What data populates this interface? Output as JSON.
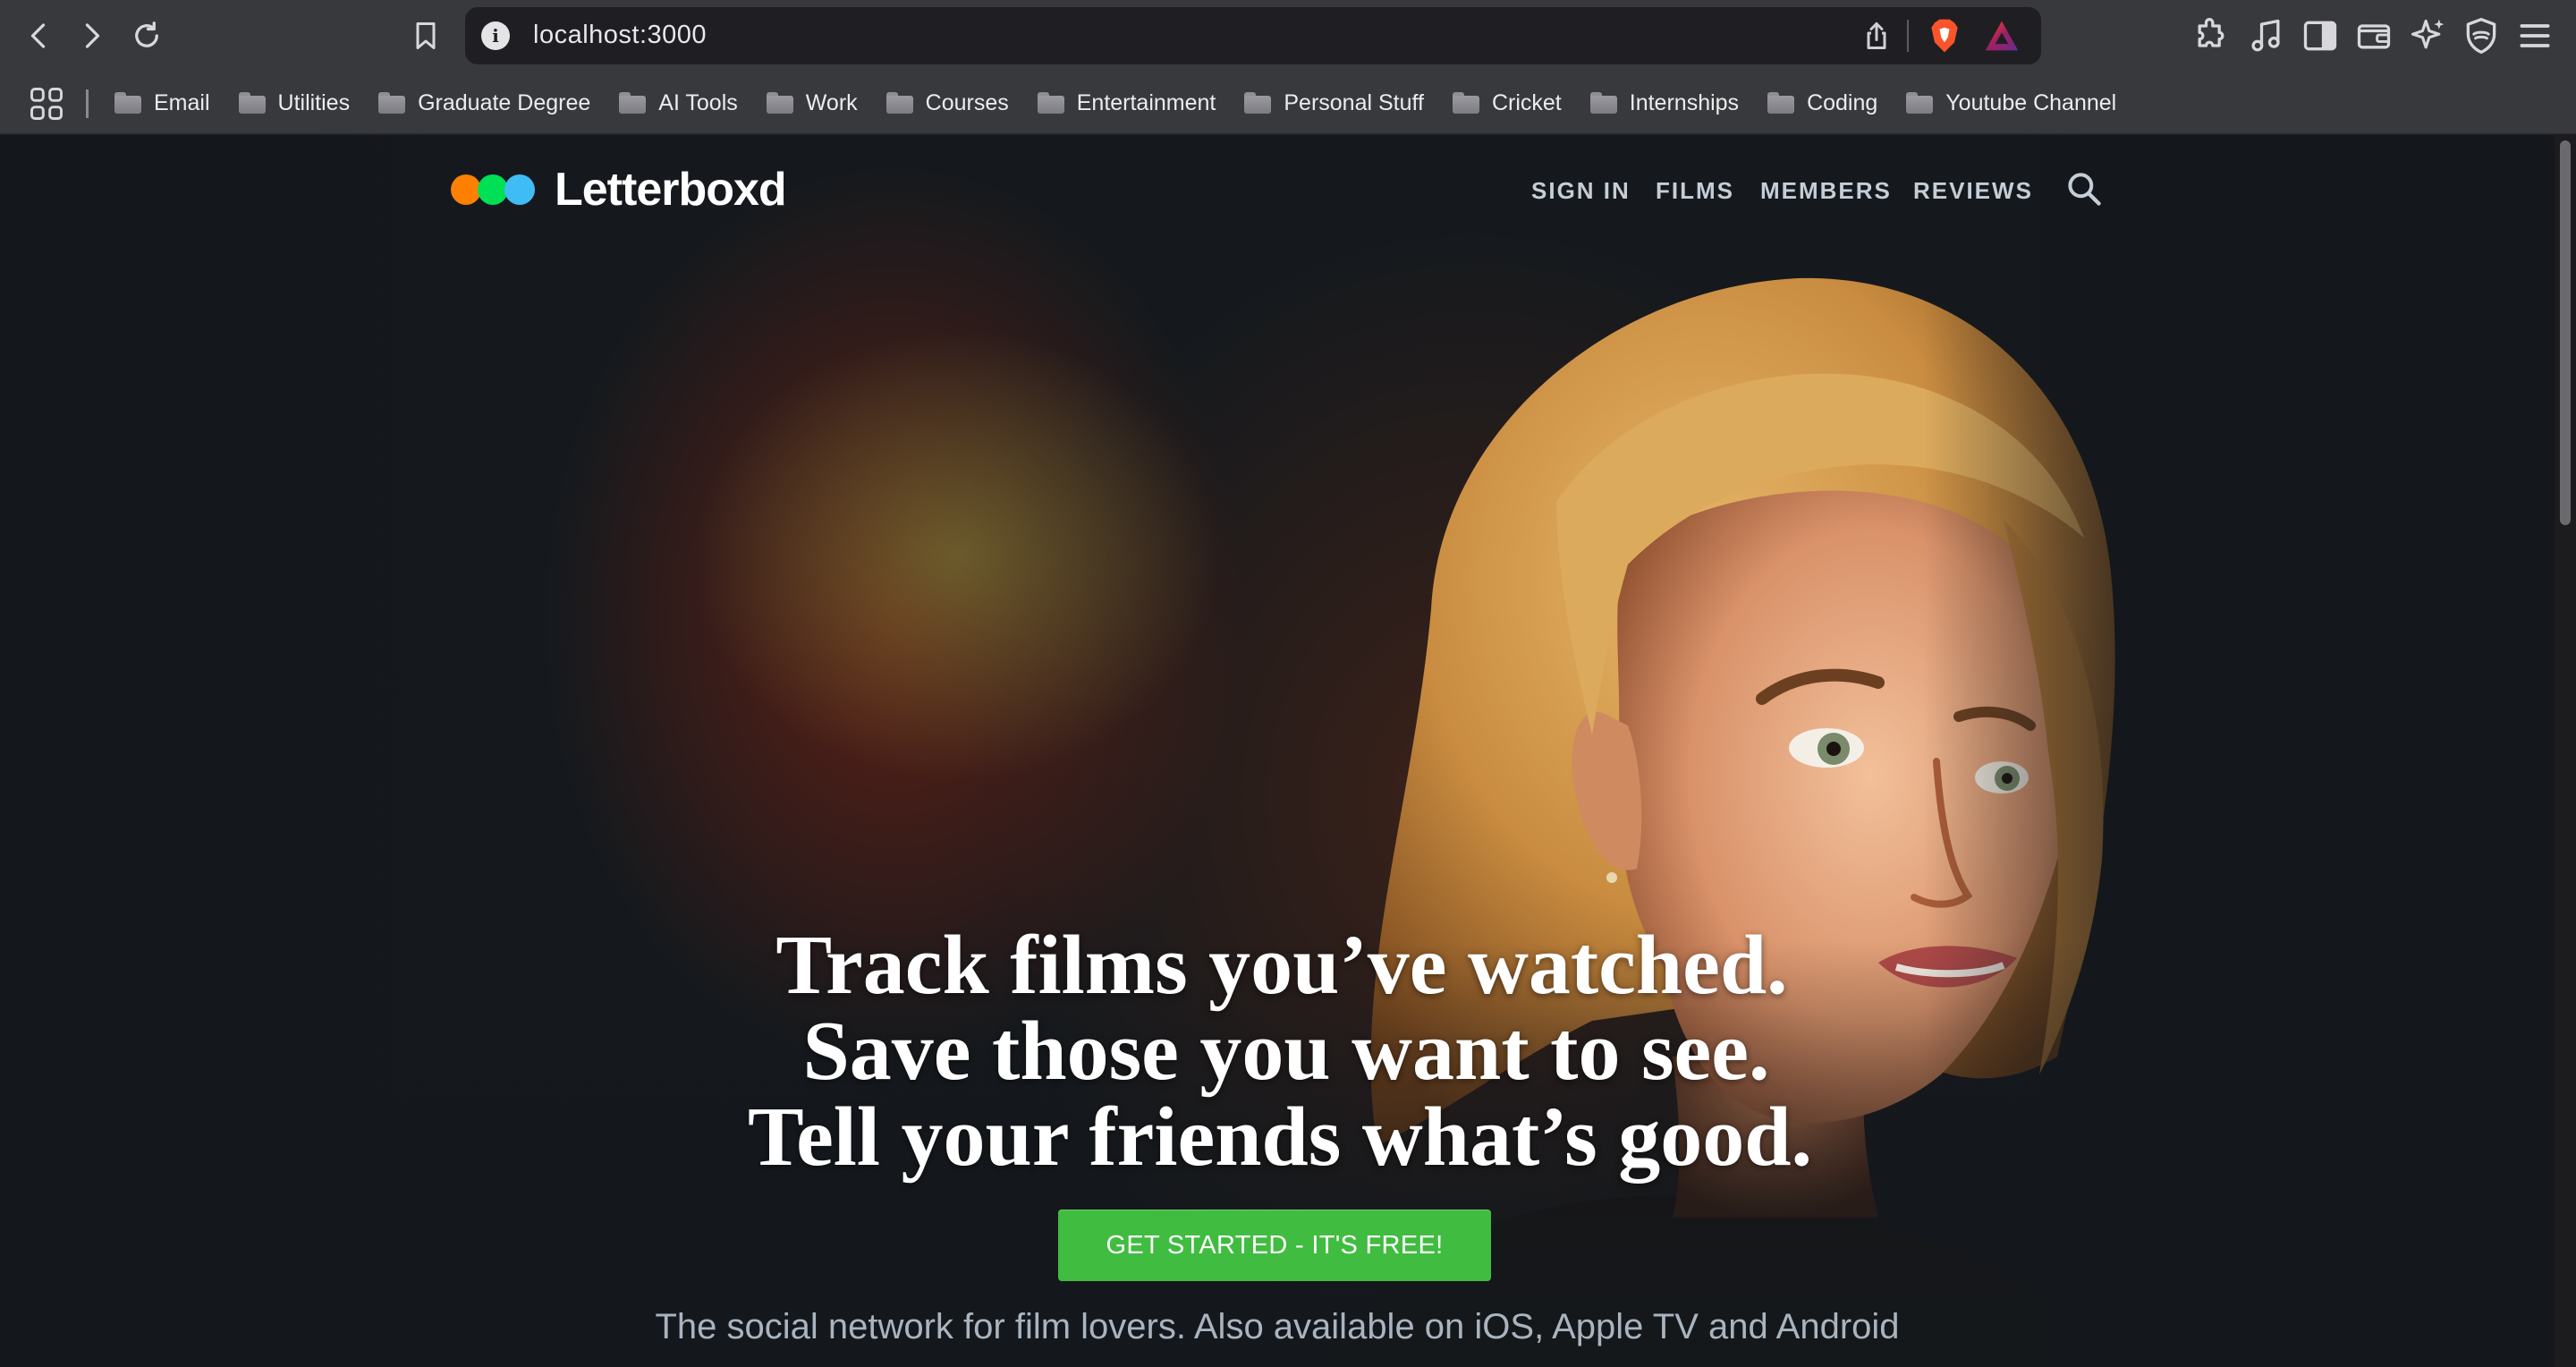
{
  "browser": {
    "url": "localhost:3000",
    "bookmarks": [
      "Email",
      "Utilities",
      "Graduate Degree",
      "AI Tools",
      "Work",
      "Courses",
      "Entertainment",
      "Personal Stuff",
      "Cricket",
      "Internships",
      "Coding",
      "Youtube Channel"
    ]
  },
  "site": {
    "logo_text": "Letterboxd",
    "logo_colors": [
      "#ff8000",
      "#00e054",
      "#40bcf4"
    ],
    "nav": {
      "sign_in": "SIGN IN",
      "films": "FILMS",
      "members": "MEMBERS",
      "reviews": "REVIEWS"
    },
    "hero": {
      "line1": "Track films you’ve watched.",
      "line2": "Save those you want to see.",
      "line3": "Tell your friends what’s good.",
      "cta": "GET STARTED - IT'S FREE!",
      "tagline": "The social network for film lovers.  Also available on iOS, Apple TV and Android"
    },
    "colors": {
      "cta_green": "#40bc40",
      "background": "#14181c",
      "nav_text": "#c5cdd6"
    }
  }
}
